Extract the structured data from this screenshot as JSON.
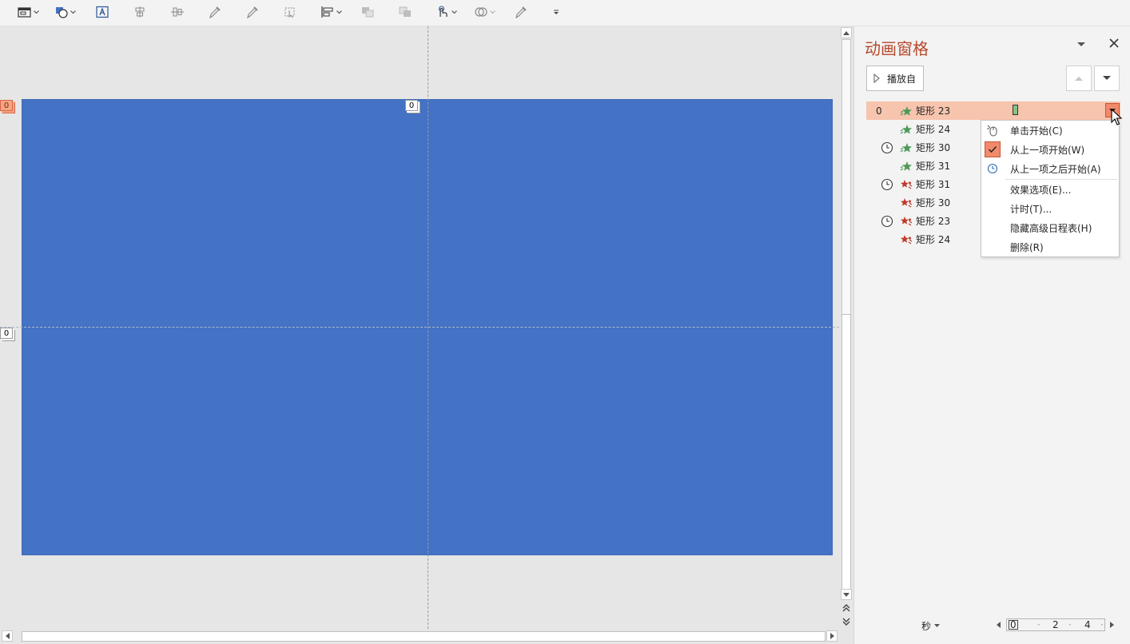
{
  "pane": {
    "title": "动画窗格",
    "play_label": "播放自"
  },
  "animations": [
    {
      "num": "0",
      "name": "矩形 23",
      "effect": "entrance",
      "clock": false
    },
    {
      "num": "",
      "name": "矩形 24",
      "effect": "entrance",
      "clock": false
    },
    {
      "num": "",
      "name": "矩形 30",
      "effect": "entrance",
      "clock": true
    },
    {
      "num": "",
      "name": "矩形 31",
      "effect": "entrance",
      "clock": false
    },
    {
      "num": "",
      "name": "矩形 31",
      "effect": "exit",
      "clock": true
    },
    {
      "num": "",
      "name": "矩形 30",
      "effect": "exit",
      "clock": false
    },
    {
      "num": "",
      "name": "矩形 23",
      "effect": "exit",
      "clock": true
    },
    {
      "num": "",
      "name": "矩形 24",
      "effect": "exit",
      "clock": false
    }
  ],
  "context_menu": [
    {
      "label": "单击开始(C)",
      "icon": "mouse-icon",
      "checked": false
    },
    {
      "label": "从上一项开始(W)",
      "icon": "check-icon",
      "checked": true
    },
    {
      "label": "从上一项之后开始(A)",
      "icon": "clock-icon",
      "checked": false
    },
    {
      "label": "效果选项(E)...",
      "icon": "",
      "checked": false
    },
    {
      "label": "计时(T)...",
      "icon": "",
      "checked": false
    },
    {
      "label": "隐藏高级日程表(H)",
      "icon": "",
      "checked": false
    },
    {
      "label": "删除(R)",
      "icon": "",
      "checked": false
    }
  ],
  "slide_tags": {
    "top_left": "0",
    "top_center": "0",
    "mid_left": "0"
  },
  "timeline": {
    "unit_label": "秒",
    "ticks": [
      "0",
      "2",
      "4"
    ]
  },
  "colors": {
    "slide_fill": "#4472c4",
    "accent": "#b7472a",
    "selected_row": "#f7c4ad",
    "entrance_star": "#4e9a5a",
    "exit_star": "#c0392b"
  }
}
